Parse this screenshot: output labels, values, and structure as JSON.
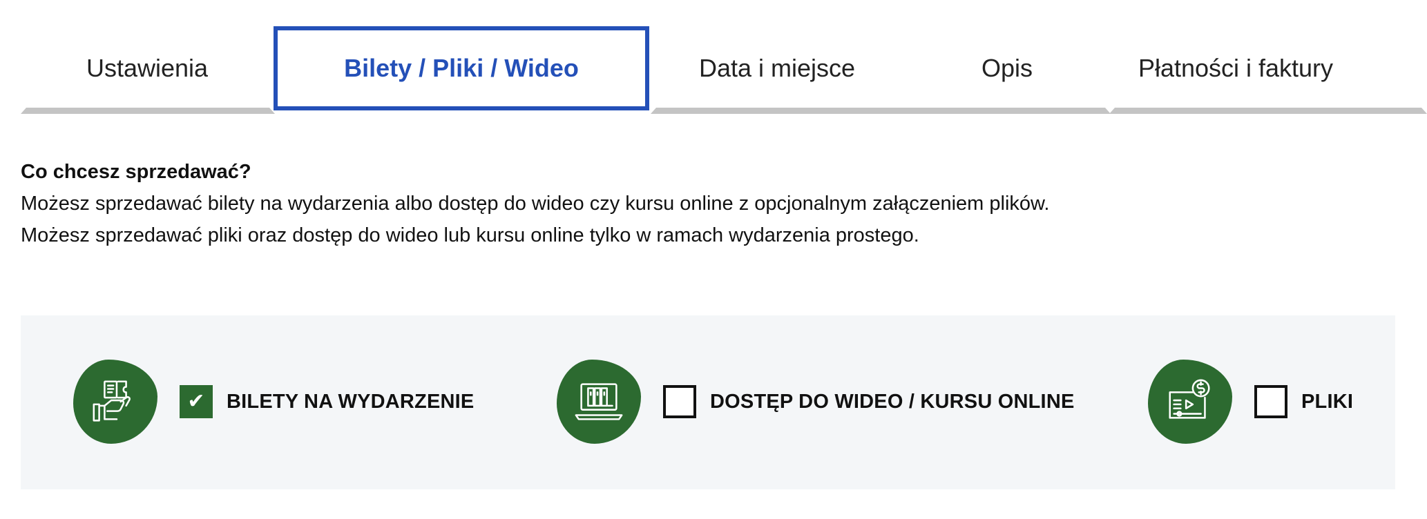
{
  "tabs": [
    {
      "label": "Ustawienia",
      "active": false
    },
    {
      "label": "Bilety / Pliki / Wideo",
      "active": true
    },
    {
      "label": "Data i miejsce",
      "active": false
    },
    {
      "label": "Opis",
      "active": false
    },
    {
      "label": "Płatności i faktury",
      "active": false
    }
  ],
  "intro": {
    "question": "Co chcesz sprzedawać?",
    "line1": "Możesz sprzedawać bilety na wydarzenia albo dostęp do wideo czy kursu online z opcjonalnym załączeniem plików.",
    "line2": "Możesz sprzedawać pliki oraz dostęp do wideo lub kursu online tylko w ramach wydarzenia prostego."
  },
  "options": [
    {
      "label": "BILETY NA WYDARZENIE",
      "checked": true,
      "icon": "ticket-hand-icon"
    },
    {
      "label": "DOSTĘP DO WIDEO / KURSU ONLINE",
      "checked": false,
      "icon": "laptop-books-icon"
    },
    {
      "label": "PLIKI",
      "checked": false,
      "icon": "video-money-icon"
    }
  ],
  "check_mark": "✔",
  "colors": {
    "accent_blue": "#2450b8",
    "brand_green": "#2c6a30",
    "tab_line": "#c4c4c4",
    "panel_bg": "#f4f6f8"
  }
}
